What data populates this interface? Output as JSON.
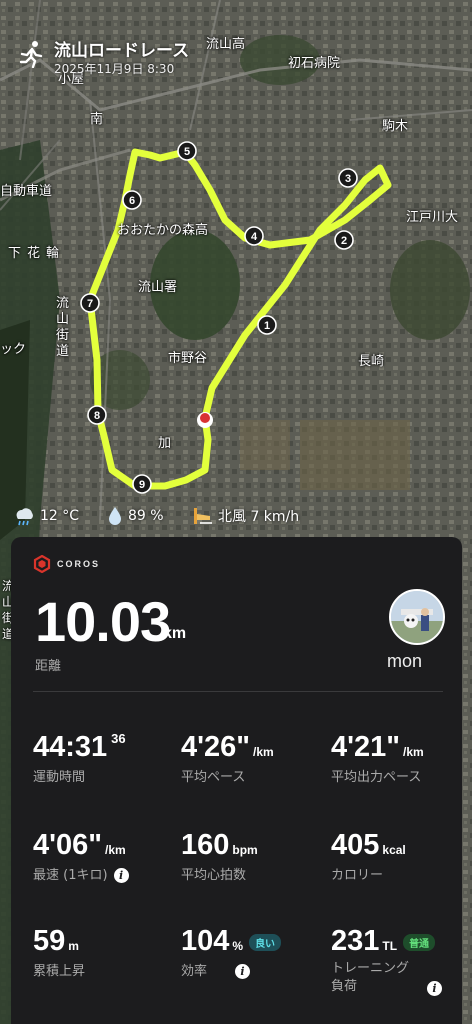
{
  "header": {
    "title": "流山ロードレース",
    "date": "2025年11月9日 8:30"
  },
  "map": {
    "labels": [
      "流山高",
      "初石病院",
      "小屋",
      "南",
      "駒木",
      "自動車道",
      "江戸川大",
      "おおたかの森高",
      "下花輪",
      "流山署",
      "流山街道",
      "ック",
      "市野谷",
      "長崎",
      "加",
      "流山街道"
    ],
    "markers": [
      "1",
      "2",
      "3",
      "4",
      "5",
      "6",
      "7",
      "8",
      "9"
    ],
    "route_color": "#e3ff3c"
  },
  "weather": {
    "temperature": "12 °C",
    "humidity": "89 %",
    "wind": "北風 7 km/h"
  },
  "card": {
    "brand": "COROS",
    "distance": {
      "value": "10.03",
      "unit": "km",
      "label": "距離"
    },
    "user": "mon",
    "stats": {
      "time": {
        "value": "44:31",
        "sup": "36",
        "label": "運動時間"
      },
      "avg_pace": {
        "value": "4'26\"",
        "unit": "/km",
        "label": "平均ペース"
      },
      "avg_power_pace": {
        "value": "4'21\"",
        "unit": "/km",
        "label": "平均出力ペース"
      },
      "fastest": {
        "value": "4'06\"",
        "unit": "/km",
        "label": "最速 (1キロ)"
      },
      "heart_rate": {
        "value": "160",
        "unit": "bpm",
        "label": "平均心拍数"
      },
      "calories": {
        "value": "405",
        "unit": "kcal",
        "label": "カロリー"
      },
      "elevation": {
        "value": "59",
        "unit": "m",
        "label": "累積上昇"
      },
      "efficiency": {
        "value": "104",
        "unit": "%",
        "badge": "良い",
        "label": "効率"
      },
      "training_load": {
        "value": "231",
        "unit": "TL",
        "badge": "普通",
        "label": "トレーニング\n負荷"
      }
    }
  },
  "colors": {
    "card_bg": "#1c1c1e",
    "route": "#e3ff3c",
    "brand_red": "#d9342b"
  }
}
